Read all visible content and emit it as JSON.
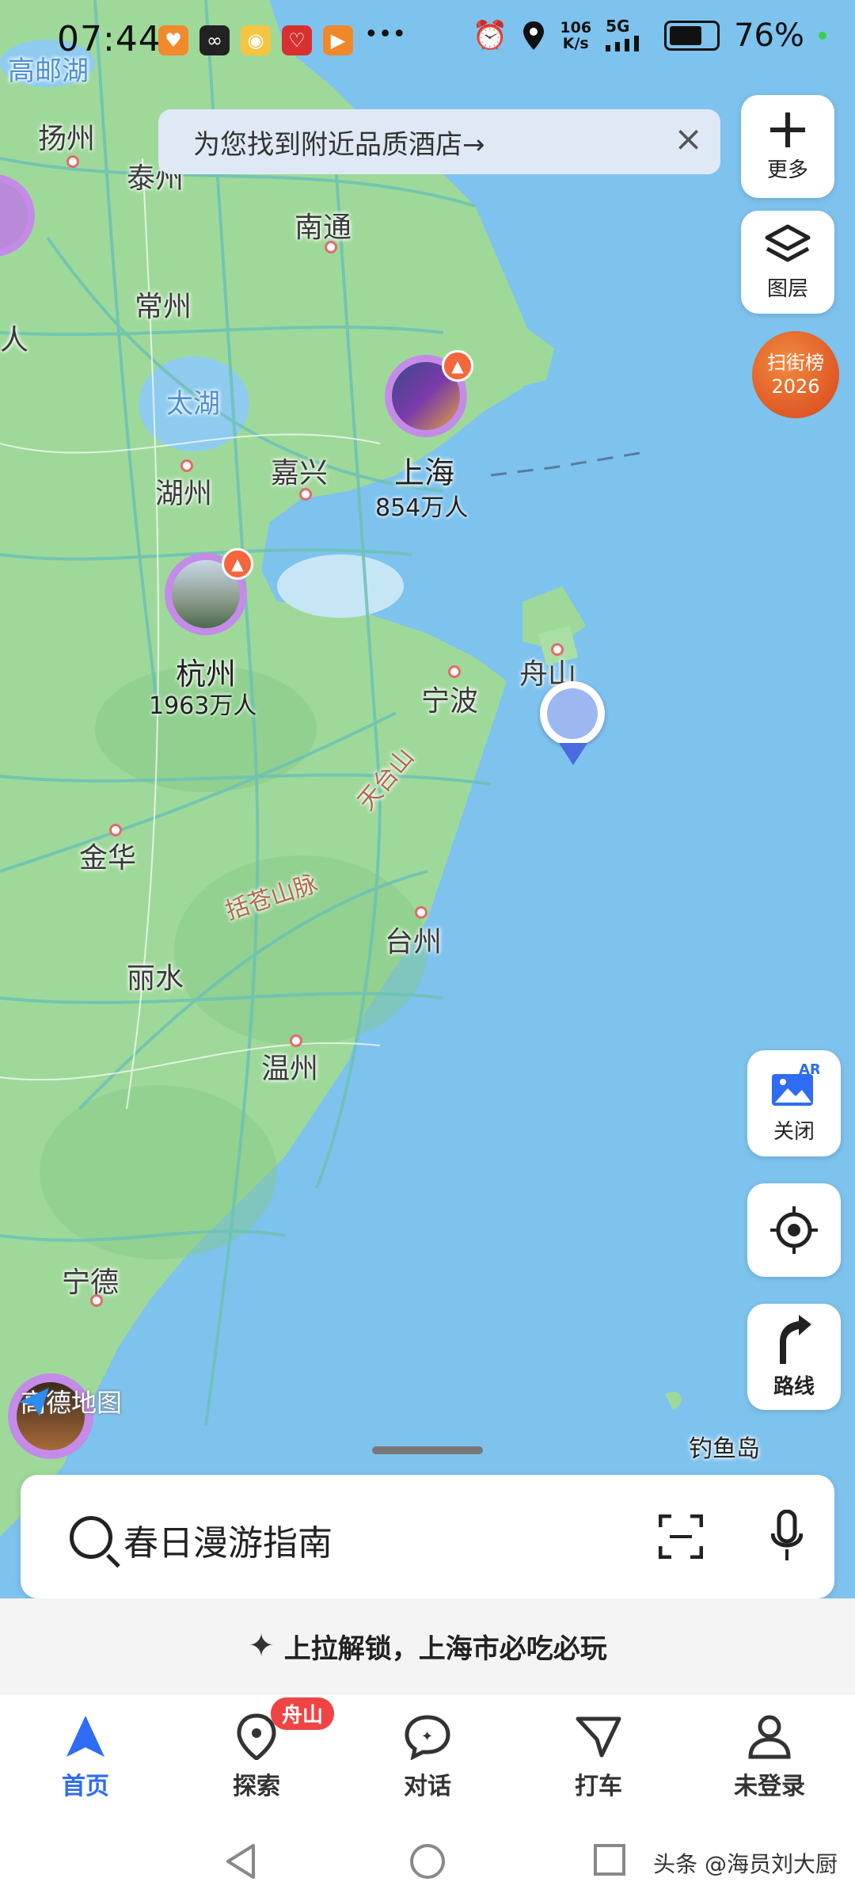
{
  "status": {
    "time": "07:44",
    "net_speed_top": "106",
    "net_speed_bottom": "K/s",
    "network": "5G",
    "battery": "76%",
    "battery_level": 0.76
  },
  "hotel_banner": {
    "text": "为您找到附近品质酒店→",
    "close": "×"
  },
  "side_buttons": {
    "more": "更多",
    "layers": "图层",
    "ar_close": "关闭",
    "route": "路线"
  },
  "rank_badge": {
    "line1": "扫街榜",
    "line2": "2026"
  },
  "map_labels": {
    "gaoyou_lake": "高邮湖",
    "yangzhou": "扬州",
    "taizhou_js": "泰州",
    "nantong": "南通",
    "changzhou": "常州",
    "taihu": "太湖",
    "huzhou": "湖州",
    "jiaxing": "嘉兴",
    "shanghai": "上海",
    "shanghai_pop": "854万人",
    "hangzhou": "杭州",
    "hangzhou_pop": "1963万人",
    "ningbo": "宁波",
    "zhoushan": "舟山",
    "tiantai": "天台山",
    "jinhua": "金华",
    "kuocang": "括苍山脉",
    "taizhou_zj": "台州",
    "lishui": "丽水",
    "wenzhou": "温州",
    "ningde": "宁德",
    "diaoyu": "钓鱼岛",
    "edge_ren": "人"
  },
  "logo": {
    "text": "高德地图"
  },
  "search": {
    "placeholder": "春日漫游指南"
  },
  "unlock": {
    "text": "上拉解锁，上海市必吃必玩"
  },
  "tabs": [
    {
      "label": "首页"
    },
    {
      "label": "探索",
      "badge": "舟山"
    },
    {
      "label": "对话"
    },
    {
      "label": "打车"
    },
    {
      "label": "未登录"
    }
  ],
  "watermark": "头条 @海员刘大厨",
  "colors": {
    "land": "#9fd99a",
    "sea": "#7ec3ee",
    "accent": "#2d6cf3",
    "road": "#7fcab9",
    "badge": "#ee4444"
  }
}
